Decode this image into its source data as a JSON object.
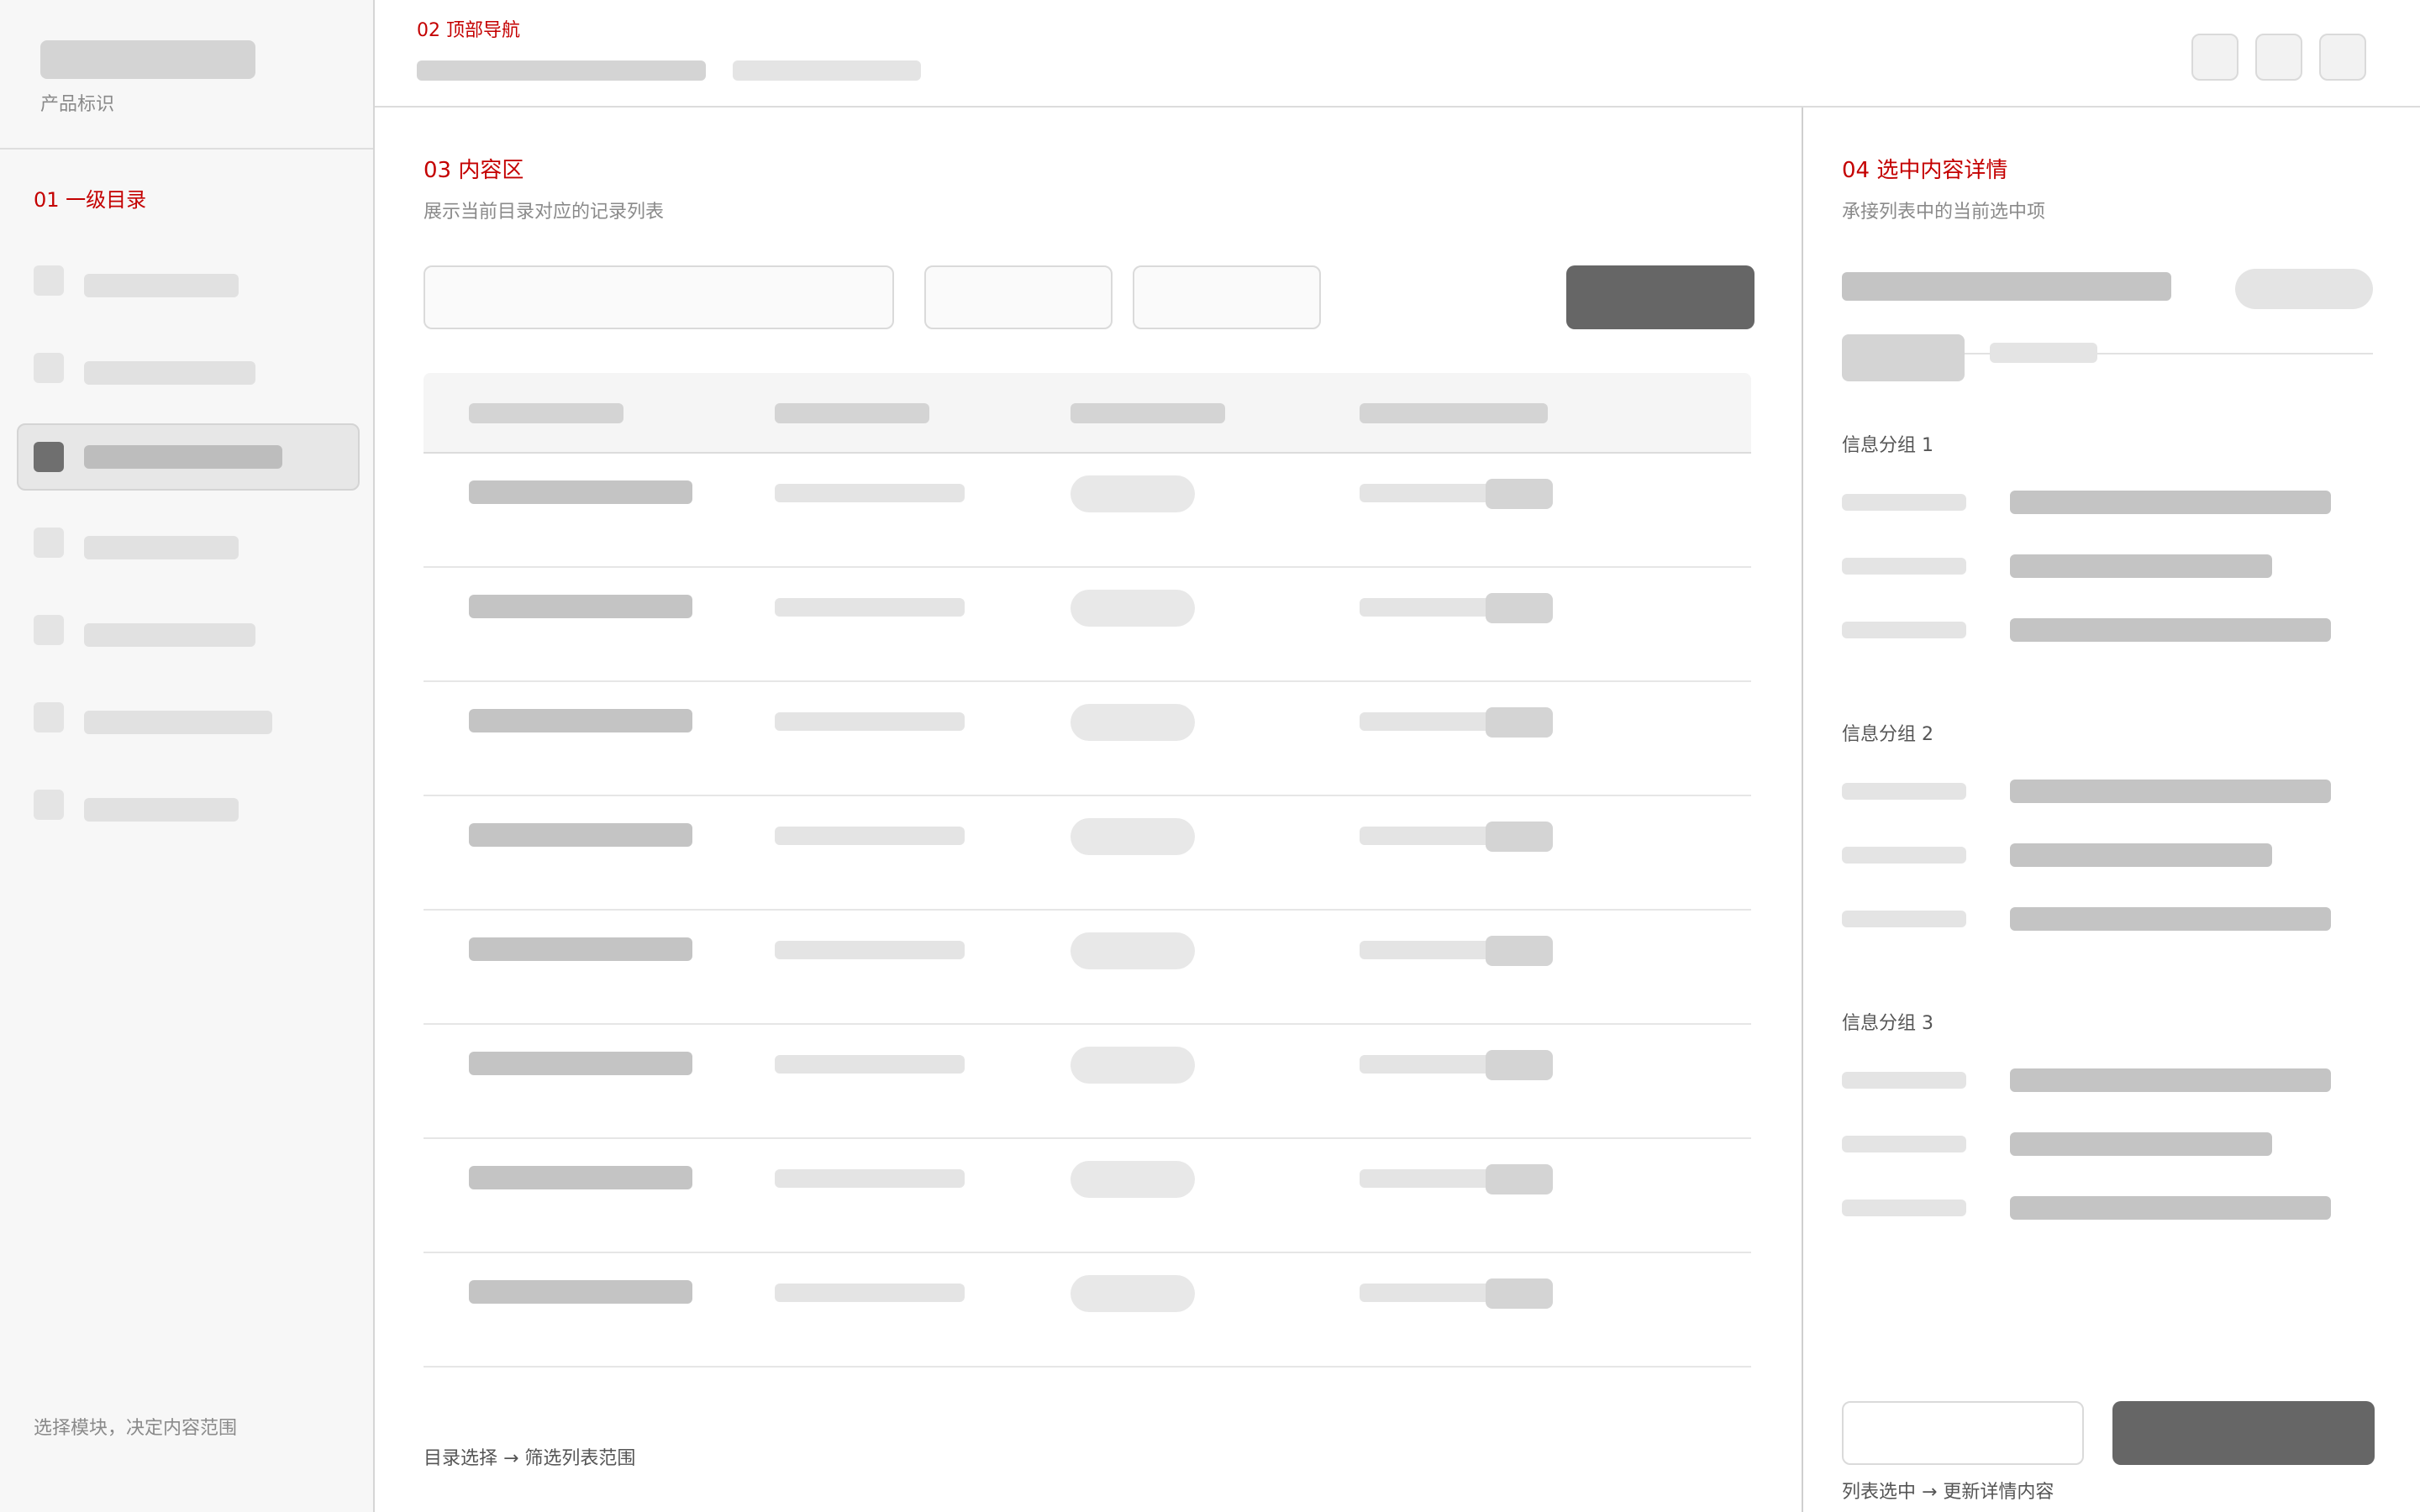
{
  "sidebar": {
    "product_label": "产品标识",
    "section_title": "01  一级目录",
    "footer_note": "选择模块，决定内容范围",
    "active_index": 2,
    "item_count": 7
  },
  "header": {
    "section_title": "02  顶部导航",
    "action_count": 3
  },
  "content": {
    "section_title": "03  内容区",
    "subtitle": "展示当前目录对应的记录列表",
    "row_count": 8,
    "footer_note": "目录选择 → 筛选列表范围"
  },
  "detail": {
    "section_title": "04  选中内容详情",
    "subtitle": "承接列表中的当前选中项",
    "groups": [
      {
        "label": "信息分组 1"
      },
      {
        "label": "信息分组 2"
      },
      {
        "label": "信息分组 3"
      }
    ],
    "footer_note": "列表选中 → 更新详情内容"
  },
  "colors": {
    "accent": "#c40000",
    "primary_button": "#666666",
    "skeleton_dark": "#c4c4c4",
    "skeleton_light": "#e4e4e4"
  }
}
